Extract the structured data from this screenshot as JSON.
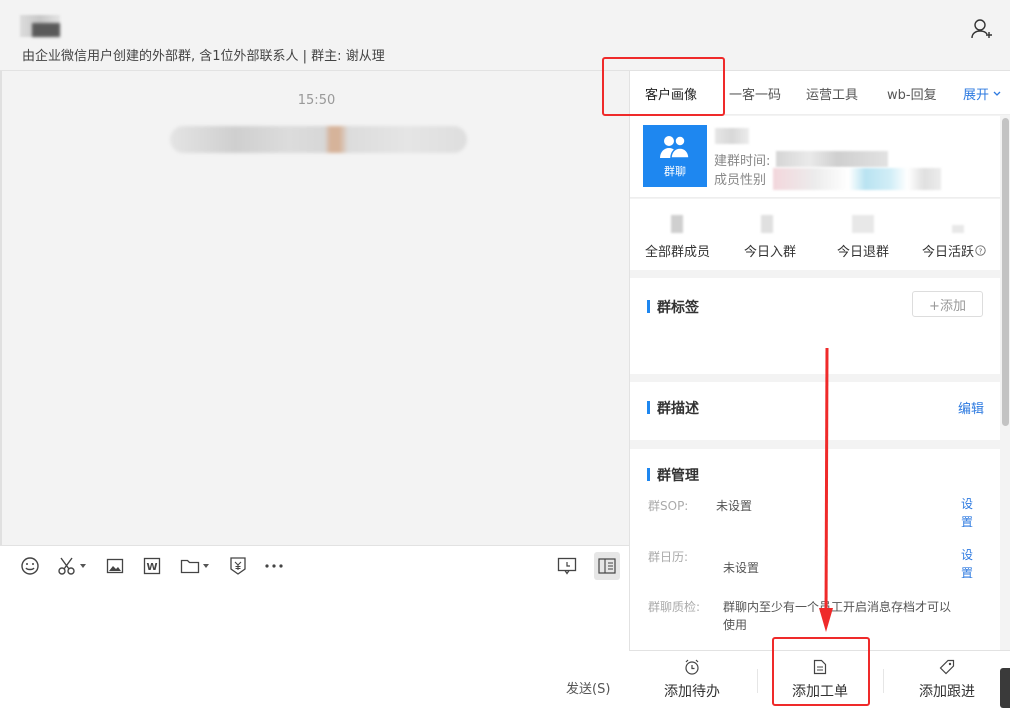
{
  "header": {
    "subtitle": "由企业微信用户创建的外部群, 含1位外部联系人  | 群主: 谢从理"
  },
  "chat": {
    "time": "15:50"
  },
  "toolbar": {
    "icons": [
      "emoji-icon",
      "scissors-icon",
      "image-icon",
      "word-icon",
      "folder-icon",
      "red-packet-icon",
      "more-icon",
      "feedback-icon",
      "sidebar-toggle-icon"
    ],
    "send_label": "发送(S)"
  },
  "panel": {
    "tabs": [
      {
        "label": "客户画像",
        "active": true
      },
      {
        "label": "一客一码"
      },
      {
        "label": "运营工具"
      },
      {
        "label": "wb-回复"
      },
      {
        "label": "展开"
      }
    ],
    "group_avatar_label": "群聊",
    "created_label": "建群时间:",
    "gender_label": "成员性别",
    "stats": [
      {
        "label": "全部群成员"
      },
      {
        "label": "今日入群"
      },
      {
        "label": "今日退群"
      },
      {
        "label": "今日活跃"
      }
    ],
    "tags": {
      "title": "群标签",
      "add_label": "+添加"
    },
    "description": {
      "title": "群描述",
      "edit_label": "编辑"
    },
    "management": {
      "title": "群管理",
      "rows": [
        {
          "label": "群SOP:",
          "value": "未设置",
          "action": "设置"
        },
        {
          "label": "群日历:",
          "value": "未设置",
          "action": "设置"
        },
        {
          "label": "群聊质检:",
          "value": "群聊内至少有一个员工开启消息存档才可以使用"
        }
      ]
    }
  },
  "bottom_bar": {
    "items": [
      {
        "label": "添加待办",
        "icon": "alarm-clock-icon"
      },
      {
        "label": "添加工单",
        "icon": "document-icon"
      },
      {
        "label": "添加跟进",
        "icon": "tag-icon"
      }
    ]
  },
  "annotation_color": "#ef2a2a",
  "accent_color": "#1e87f0"
}
